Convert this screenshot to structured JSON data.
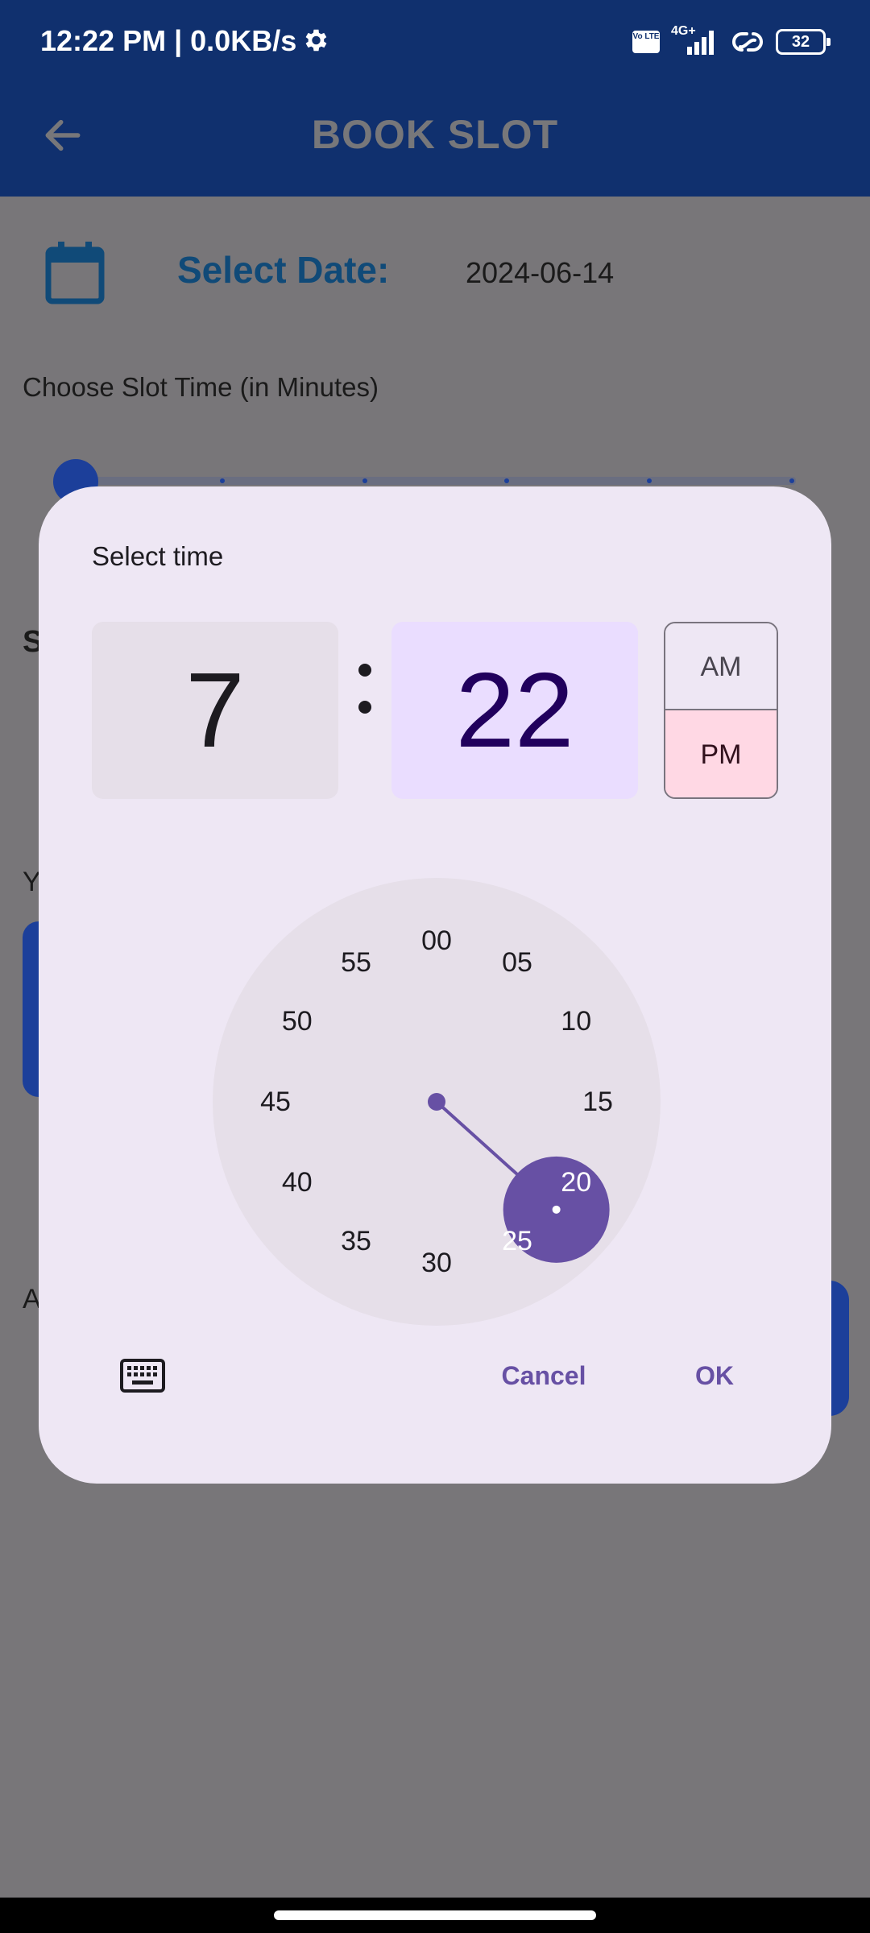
{
  "status_bar": {
    "time": "12:22 PM | 0.0KB/s",
    "network": "4G+",
    "volte": "Vo LTE",
    "battery": "32"
  },
  "app_bar": {
    "title": "BOOK SLOT"
  },
  "form": {
    "select_date_label": "Select Date:",
    "date_value": "2024-06-14",
    "slot_time_label": "Choose Slot Time (in Minutes)",
    "slot_slider_value": 0,
    "partial_labels": {
      "s": "S",
      "y": "Y",
      "a": "A"
    }
  },
  "time_picker": {
    "title": "Select time",
    "hour": "7",
    "minute": "22",
    "period_selected": "PM",
    "am_label": "AM",
    "pm_label": "PM",
    "dial_labels": [
      "00",
      "05",
      "10",
      "15",
      "20",
      "25",
      "30",
      "35",
      "40",
      "45",
      "50",
      "55"
    ],
    "selected_minute_value": 22,
    "cancel_label": "Cancel",
    "ok_label": "OK",
    "colors": {
      "dialog_bg": "#eee7f4",
      "dial_bg": "#e6dfe9",
      "accent": "#6750a4",
      "minute_box": "#eaddff",
      "pm_selected": "#ffd8e4"
    }
  },
  "colors": {
    "app_bar": "#10306e",
    "scrim": "#787679",
    "select_date_label": "#104a78"
  }
}
